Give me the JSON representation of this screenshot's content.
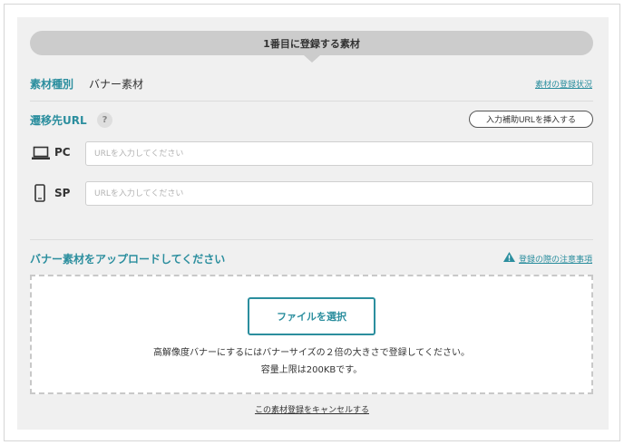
{
  "step_header": "1番目に登録する素材",
  "material_type": {
    "label": "素材種別",
    "value": "バナー素材",
    "status_link": "素材の登録状況"
  },
  "url_section": {
    "label": "遷移先URL",
    "help_icon": "?",
    "insert_button": "入力補助URLを挿入する",
    "pc": {
      "label": "PC",
      "icon": "laptop-icon",
      "value": "",
      "placeholder": "URLを入力してください"
    },
    "sp": {
      "label": "SP",
      "icon": "smartphone-icon",
      "value": "",
      "placeholder": "URLを入力してください"
    }
  },
  "upload_section": {
    "label": "バナー素材をアップロードしてください",
    "notice_link": "登録の際の注意事項",
    "notice_icon": "warning-icon",
    "select_file_button": "ファイルを選択",
    "hint_line_1": "高解像度バナーにするにはバナーサイズの２倍の大きさで登録してください。",
    "hint_line_2": "容量上限は200KBです。"
  },
  "cancel_link": "この素材登録をキャンセルする",
  "colors": {
    "accent": "#2b8e9e",
    "panel_bg": "#f0f0f0",
    "header_bg": "#cccccc"
  }
}
